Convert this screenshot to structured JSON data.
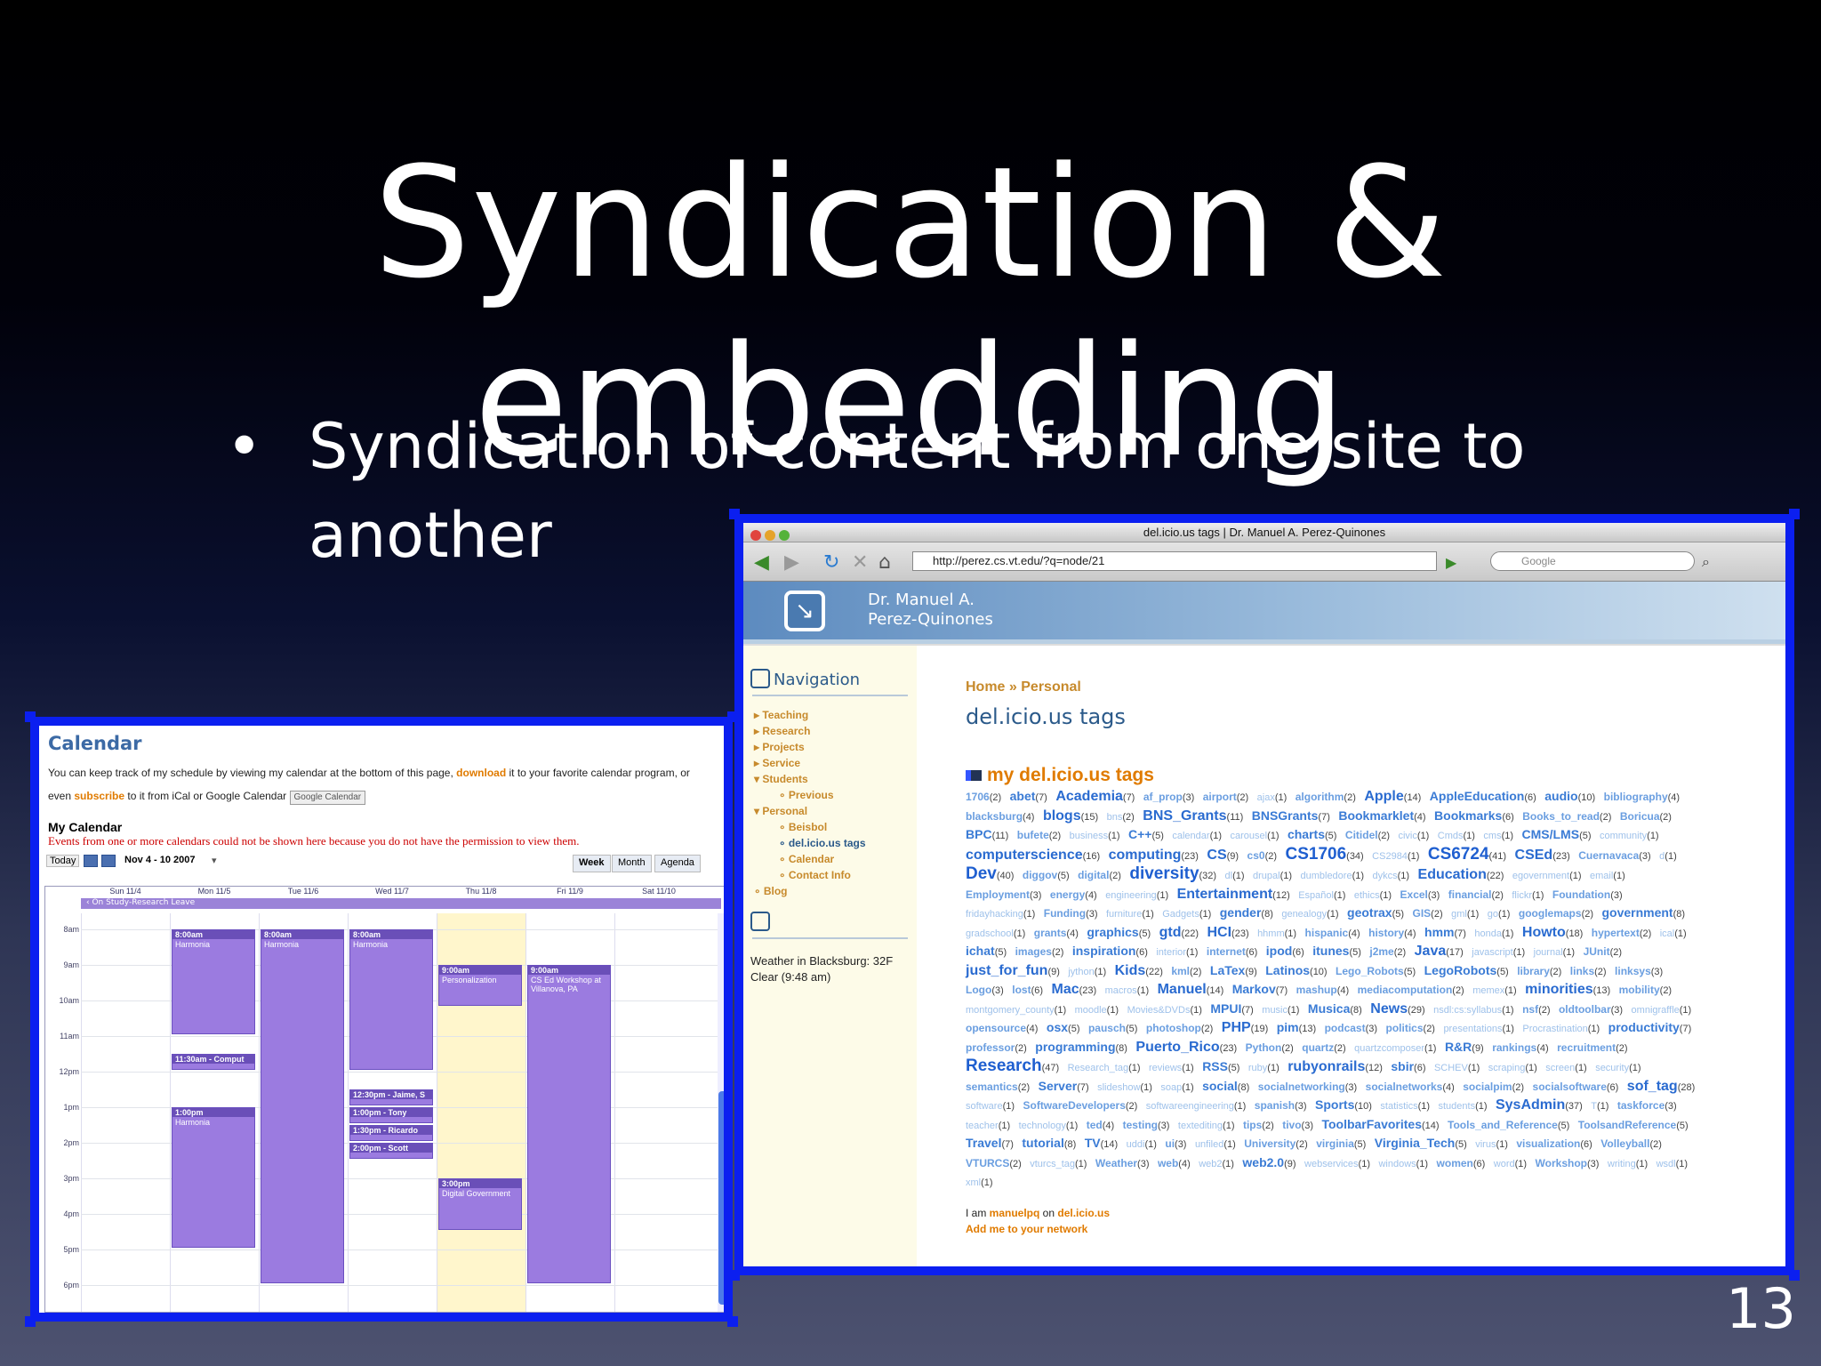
{
  "slide": {
    "title": "Syndication & embedding",
    "bullet_text": "Syndication of content from one site to another",
    "bullet_glyph": "•",
    "slide_number": "13",
    "accent": "#0b1ff0"
  },
  "calendar": {
    "heading": "Calendar",
    "intro_a": "You can keep track of my schedule by viewing my calendar at the bottom of this page, ",
    "download": "download",
    "intro_b": " it to your favorite calendar program, or even ",
    "subscribe": "subscribe",
    "intro_c": " to it from iCal or Google Calendar",
    "gc_button": "Google Calendar",
    "my_calendar": "My Calendar",
    "error": "Events from one or more calendars could not be shown here because you do not have the permission to view them.",
    "today": "Today",
    "range": "Nov 4 - 10 2007",
    "views": [
      "Week",
      "Month",
      "Agenda"
    ],
    "days": [
      "Sun 11/4",
      "Mon 11/5",
      "Tue 11/6",
      "Wed 11/7",
      "Thu 11/8",
      "Fri 11/9",
      "Sat 11/10"
    ],
    "allday": "On Study-Research Leave",
    "hours": [
      "8am",
      "9am",
      "10am",
      "11am",
      "12pm",
      "1pm",
      "2pm",
      "3pm",
      "4pm",
      "5pm",
      "6pm"
    ],
    "events": [
      {
        "day": 1,
        "start": 8,
        "end": 11,
        "time": "8:00am",
        "title": "Harmonia"
      },
      {
        "day": 2,
        "start": 8,
        "end": 18,
        "time": "8:00am",
        "title": "Harmonia"
      },
      {
        "day": 3,
        "start": 8,
        "end": 12,
        "time": "8:00am",
        "title": "Harmonia"
      },
      {
        "day": 1,
        "start": 11.5,
        "end": 12,
        "time": "11:30am - Comput",
        "title": ""
      },
      {
        "day": 1,
        "start": 13,
        "end": 17,
        "time": "1:00pm",
        "title": "Harmonia"
      },
      {
        "day": 4,
        "start": 9,
        "end": 10.2,
        "time": "9:00am",
        "title": "Personalization"
      },
      {
        "day": 5,
        "start": 9,
        "end": 18,
        "time": "9:00am",
        "title": "CS Ed Workshop at Villanova, PA"
      },
      {
        "day": 3,
        "start": 12.5,
        "end": 13,
        "time": "12:30pm - Jaime, S",
        "title": ""
      },
      {
        "day": 3,
        "start": 13,
        "end": 13.5,
        "time": "1:00pm - Tony",
        "title": ""
      },
      {
        "day": 3,
        "start": 13.5,
        "end": 14,
        "time": "1:30pm - Ricardo",
        "title": ""
      },
      {
        "day": 3,
        "start": 14,
        "end": 14.5,
        "time": "2:00pm - Scott",
        "title": ""
      },
      {
        "day": 4,
        "start": 15,
        "end": 16.5,
        "time": "3:00pm",
        "title": "Digital Government"
      }
    ]
  },
  "browser": {
    "window_title": "del.icio.us tags | Dr. Manuel A. Perez-Quinones",
    "url": "http://perez.cs.vt.edu/?q=node/21",
    "search_placeholder": "Google",
    "site_name_1": "Dr. Manuel A.",
    "site_name_2": "Perez-Quinones",
    "nav_heading": "Navigation",
    "nav_items": [
      "Teaching",
      "Research",
      "Projects",
      "Service",
      "Students",
      "Previous",
      "Personal",
      "Beisbol",
      "del.icio.us tags",
      "Calendar",
      "Contact Info",
      "Blog"
    ],
    "weather": "Weather in Blacksburg: 32F Clear (9:48 am)",
    "breadcrumb": "Home » Personal",
    "page_title": "del.icio.us tags",
    "tags_heading": "my del.icio.us tags",
    "footer_a": "I am ",
    "footer_user": "manuelpq",
    "footer_on": " on ",
    "footer_site": "del.icio.us",
    "footer_add": "Add me to your network",
    "tags": [
      [
        "1706",
        2,
        1
      ],
      [
        "abet",
        7,
        2
      ],
      [
        "Academia",
        7,
        3
      ],
      [
        "af_prop",
        3,
        1
      ],
      [
        "airport",
        2,
        1
      ],
      [
        "ajax",
        1,
        0
      ],
      [
        "algorithm",
        2,
        1
      ],
      [
        "Apple",
        14,
        3
      ],
      [
        "AppleEducation",
        6,
        2
      ],
      [
        "audio",
        10,
        2
      ],
      [
        "bibliography",
        4,
        1
      ],
      [
        "blacksburg",
        4,
        1
      ],
      [
        "blogs",
        15,
        3
      ],
      [
        "bns",
        2,
        0
      ],
      [
        "BNS_Grants",
        11,
        3
      ],
      [
        "BNSGrants",
        7,
        2
      ],
      [
        "Bookmarklet",
        4,
        2
      ],
      [
        "Bookmarks",
        6,
        2
      ],
      [
        "Books_to_read",
        2,
        1
      ],
      [
        "Boricua",
        2,
        1
      ],
      [
        "BPC",
        11,
        2
      ],
      [
        "bufete",
        2,
        1
      ],
      [
        "business",
        1,
        0
      ],
      [
        "C++",
        5,
        2
      ],
      [
        "calendar",
        1,
        0
      ],
      [
        "carousel",
        1,
        0
      ],
      [
        "charts",
        5,
        2
      ],
      [
        "Citidel",
        2,
        1
      ],
      [
        "civic",
        1,
        0
      ],
      [
        "Cmds",
        1,
        0
      ],
      [
        "cms",
        1,
        0
      ],
      [
        "CMS/LMS",
        5,
        2
      ],
      [
        "community",
        1,
        0
      ],
      [
        "computerscience",
        16,
        3
      ],
      [
        "computing",
        23,
        3
      ],
      [
        "CS",
        9,
        3
      ],
      [
        "cs0",
        2,
        1
      ],
      [
        "CS1706",
        34,
        4
      ],
      [
        "CS2984",
        1,
        0
      ],
      [
        "CS6724",
        41,
        4
      ],
      [
        "CSEd",
        23,
        3
      ],
      [
        "Cuernavaca",
        3,
        1
      ],
      [
        "d",
        1,
        0
      ],
      [
        "Dev",
        40,
        4
      ],
      [
        "diggov",
        5,
        1
      ],
      [
        "digital",
        2,
        1
      ],
      [
        "diversity",
        32,
        4
      ],
      [
        "dl",
        1,
        0
      ],
      [
        "drupal",
        1,
        0
      ],
      [
        "dumbledore",
        1,
        0
      ],
      [
        "dykcs",
        1,
        0
      ],
      [
        "Education",
        22,
        3
      ],
      [
        "egovernment",
        1,
        0
      ],
      [
        "email",
        1,
        0
      ],
      [
        "Employment",
        3,
        1
      ],
      [
        "energy",
        4,
        1
      ],
      [
        "engineering",
        1,
        0
      ],
      [
        "Entertainment",
        12,
        3
      ],
      [
        "Español",
        1,
        0
      ],
      [
        "ethics",
        1,
        0
      ],
      [
        "Excel",
        3,
        1
      ],
      [
        "financial",
        2,
        1
      ],
      [
        "flickr",
        1,
        0
      ],
      [
        "Foundation",
        3,
        1
      ],
      [
        "fridayhacking",
        1,
        0
      ],
      [
        "Funding",
        3,
        1
      ],
      [
        "furniture",
        1,
        0
      ],
      [
        "Gadgets",
        1,
        0
      ],
      [
        "gender",
        8,
        2
      ],
      [
        "genealogy",
        1,
        0
      ],
      [
        "geotrax",
        5,
        2
      ],
      [
        "GIS",
        2,
        1
      ],
      [
        "gml",
        1,
        0
      ],
      [
        "go",
        1,
        0
      ],
      [
        "googlemaps",
        2,
        1
      ],
      [
        "government",
        8,
        2
      ],
      [
        "gradschool",
        1,
        0
      ],
      [
        "grants",
        4,
        1
      ],
      [
        "graphics",
        5,
        2
      ],
      [
        "gtd",
        22,
        3
      ],
      [
        "HCI",
        23,
        3
      ],
      [
        "hhmm",
        1,
        0
      ],
      [
        "hispanic",
        4,
        1
      ],
      [
        "history",
        4,
        1
      ],
      [
        "hmm",
        7,
        2
      ],
      [
        "honda",
        1,
        0
      ],
      [
        "Howto",
        18,
        3
      ],
      [
        "hypertext",
        2,
        1
      ],
      [
        "ical",
        1,
        0
      ],
      [
        "ichat",
        5,
        2
      ],
      [
        "images",
        2,
        1
      ],
      [
        "inspiration",
        6,
        2
      ],
      [
        "interior",
        1,
        0
      ],
      [
        "internet",
        6,
        1
      ],
      [
        "ipod",
        6,
        2
      ],
      [
        "itunes",
        5,
        2
      ],
      [
        "j2me",
        2,
        1
      ],
      [
        "Java",
        17,
        3
      ],
      [
        "javascript",
        1,
        0
      ],
      [
        "journal",
        1,
        0
      ],
      [
        "JUnit",
        2,
        1
      ],
      [
        "just_for_fun",
        9,
        3
      ],
      [
        "jython",
        1,
        0
      ],
      [
        "Kids",
        22,
        3
      ],
      [
        "kml",
        2,
        1
      ],
      [
        "LaTex",
        9,
        2
      ],
      [
        "Latinos",
        10,
        2
      ],
      [
        "Lego_Robots",
        5,
        1
      ],
      [
        "LegoRobots",
        5,
        2
      ],
      [
        "library",
        2,
        1
      ],
      [
        "links",
        2,
        1
      ],
      [
        "linksys",
        3,
        1
      ],
      [
        "Logo",
        3,
        1
      ],
      [
        "lost",
        6,
        1
      ],
      [
        "Mac",
        23,
        3
      ],
      [
        "macros",
        1,
        0
      ],
      [
        "Manuel",
        14,
        3
      ],
      [
        "Markov",
        7,
        2
      ],
      [
        "mashup",
        4,
        1
      ],
      [
        "mediacomputation",
        2,
        1
      ],
      [
        "memex",
        1,
        0
      ],
      [
        "minorities",
        13,
        3
      ],
      [
        "mobility",
        2,
        1
      ],
      [
        "montgomery_county",
        1,
        0
      ],
      [
        "moodle",
        1,
        0
      ],
      [
        "Movies&DVDs",
        1,
        0
      ],
      [
        "MPUI",
        7,
        2
      ],
      [
        "music",
        1,
        0
      ],
      [
        "Musica",
        8,
        2
      ],
      [
        "News",
        29,
        3
      ],
      [
        "nsdl:cs:syllabus",
        1,
        0
      ],
      [
        "nsf",
        2,
        1
      ],
      [
        "oldtoolbar",
        3,
        1
      ],
      [
        "omnigraffle",
        1,
        0
      ],
      [
        "opensource",
        4,
        1
      ],
      [
        "osx",
        5,
        2
      ],
      [
        "pausch",
        5,
        1
      ],
      [
        "photoshop",
        2,
        1
      ],
      [
        "PHP",
        19,
        3
      ],
      [
        "pim",
        13,
        2
      ],
      [
        "podcast",
        3,
        1
      ],
      [
        "politics",
        2,
        1
      ],
      [
        "presentations",
        1,
        0
      ],
      [
        "Procrastination",
        1,
        0
      ],
      [
        "productivity",
        7,
        2
      ],
      [
        "professor",
        2,
        1
      ],
      [
        "programming",
        8,
        2
      ],
      [
        "Puerto_Rico",
        23,
        3
      ],
      [
        "Python",
        2,
        1
      ],
      [
        "quartz",
        2,
        1
      ],
      [
        "quartzcomposer",
        1,
        0
      ],
      [
        "R&R",
        9,
        2
      ],
      [
        "rankings",
        4,
        1
      ],
      [
        "recruitment",
        2,
        1
      ],
      [
        "Research",
        47,
        4
      ],
      [
        "Research_tag",
        1,
        0
      ],
      [
        "reviews",
        1,
        0
      ],
      [
        "RSS",
        5,
        2
      ],
      [
        "ruby",
        1,
        0
      ],
      [
        "rubyonrails",
        12,
        3
      ],
      [
        "sbir",
        6,
        2
      ],
      [
        "SCHEV",
        1,
        0
      ],
      [
        "scraping",
        1,
        0
      ],
      [
        "screen",
        1,
        0
      ],
      [
        "security",
        1,
        0
      ],
      [
        "semantics",
        2,
        1
      ],
      [
        "Server",
        7,
        2
      ],
      [
        "slideshow",
        1,
        0
      ],
      [
        "soap",
        1,
        0
      ],
      [
        "social",
        8,
        2
      ],
      [
        "socialnetworking",
        3,
        1
      ],
      [
        "socialnetworks",
        4,
        1
      ],
      [
        "socialpim",
        2,
        1
      ],
      [
        "socialsoftware",
        6,
        1
      ],
      [
        "sof_tag",
        28,
        3
      ],
      [
        "software",
        1,
        0
      ],
      [
        "SoftwareDevelopers",
        2,
        1
      ],
      [
        "softwareengineering",
        1,
        0
      ],
      [
        "spanish",
        3,
        1
      ],
      [
        "Sports",
        10,
        2
      ],
      [
        "statistics",
        1,
        0
      ],
      [
        "students",
        1,
        0
      ],
      [
        "SysAdmin",
        37,
        3
      ],
      [
        "T",
        1,
        0
      ],
      [
        "taskforce",
        3,
        1
      ],
      [
        "teacher",
        1,
        0
      ],
      [
        "technology",
        1,
        0
      ],
      [
        "ted",
        4,
        1
      ],
      [
        "testing",
        3,
        1
      ],
      [
        "textediting",
        1,
        0
      ],
      [
        "tips",
        2,
        1
      ],
      [
        "tivo",
        3,
        1
      ],
      [
        "ToolbarFavorites",
        14,
        2
      ],
      [
        "Tools_and_Reference",
        5,
        1
      ],
      [
        "ToolsandReference",
        5,
        1
      ],
      [
        "Travel",
        7,
        2
      ],
      [
        "tutorial",
        8,
        2
      ],
      [
        "TV",
        14,
        2
      ],
      [
        "uddi",
        1,
        0
      ],
      [
        "ui",
        3,
        1
      ],
      [
        "unfiled",
        1,
        0
      ],
      [
        "University",
        2,
        1
      ],
      [
        "virginia",
        5,
        1
      ],
      [
        "Virginia_Tech",
        5,
        2
      ],
      [
        "virus",
        1,
        0
      ],
      [
        "visualization",
        6,
        1
      ],
      [
        "Volleyball",
        2,
        1
      ],
      [
        "VTURCS",
        2,
        1
      ],
      [
        "vturcs_tag",
        1,
        0
      ],
      [
        "Weather",
        3,
        1
      ],
      [
        "web",
        4,
        1
      ],
      [
        "web2",
        1,
        0
      ],
      [
        "web2.0",
        9,
        2
      ],
      [
        "webservices",
        1,
        0
      ],
      [
        "windows",
        1,
        0
      ],
      [
        "women",
        6,
        1
      ],
      [
        "word",
        1,
        0
      ],
      [
        "Workshop",
        3,
        1
      ],
      [
        "writing",
        1,
        0
      ],
      [
        "wsdl",
        1,
        0
      ],
      [
        "xml",
        1,
        0
      ]
    ]
  }
}
